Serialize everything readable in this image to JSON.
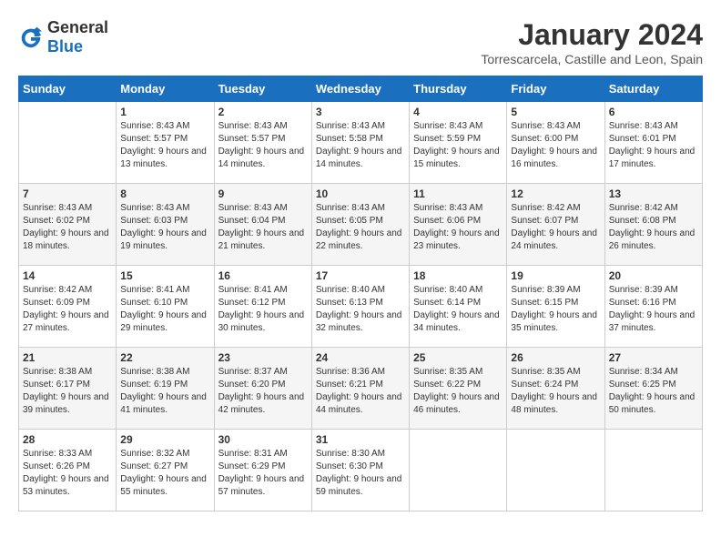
{
  "header": {
    "logo_general": "General",
    "logo_blue": "Blue",
    "month": "January 2024",
    "location": "Torrescarcela, Castille and Leon, Spain"
  },
  "calendar": {
    "days_of_week": [
      "Sunday",
      "Monday",
      "Tuesday",
      "Wednesday",
      "Thursday",
      "Friday",
      "Saturday"
    ],
    "weeks": [
      [
        {
          "day": "",
          "sunrise": "",
          "sunset": "",
          "daylight": ""
        },
        {
          "day": "1",
          "sunrise": "Sunrise: 8:43 AM",
          "sunset": "Sunset: 5:57 PM",
          "daylight": "Daylight: 9 hours and 13 minutes."
        },
        {
          "day": "2",
          "sunrise": "Sunrise: 8:43 AM",
          "sunset": "Sunset: 5:57 PM",
          "daylight": "Daylight: 9 hours and 14 minutes."
        },
        {
          "day": "3",
          "sunrise": "Sunrise: 8:43 AM",
          "sunset": "Sunset: 5:58 PM",
          "daylight": "Daylight: 9 hours and 14 minutes."
        },
        {
          "day": "4",
          "sunrise": "Sunrise: 8:43 AM",
          "sunset": "Sunset: 5:59 PM",
          "daylight": "Daylight: 9 hours and 15 minutes."
        },
        {
          "day": "5",
          "sunrise": "Sunrise: 8:43 AM",
          "sunset": "Sunset: 6:00 PM",
          "daylight": "Daylight: 9 hours and 16 minutes."
        },
        {
          "day": "6",
          "sunrise": "Sunrise: 8:43 AM",
          "sunset": "Sunset: 6:01 PM",
          "daylight": "Daylight: 9 hours and 17 minutes."
        }
      ],
      [
        {
          "day": "7",
          "sunrise": "Sunrise: 8:43 AM",
          "sunset": "Sunset: 6:02 PM",
          "daylight": "Daylight: 9 hours and 18 minutes."
        },
        {
          "day": "8",
          "sunrise": "Sunrise: 8:43 AM",
          "sunset": "Sunset: 6:03 PM",
          "daylight": "Daylight: 9 hours and 19 minutes."
        },
        {
          "day": "9",
          "sunrise": "Sunrise: 8:43 AM",
          "sunset": "Sunset: 6:04 PM",
          "daylight": "Daylight: 9 hours and 21 minutes."
        },
        {
          "day": "10",
          "sunrise": "Sunrise: 8:43 AM",
          "sunset": "Sunset: 6:05 PM",
          "daylight": "Daylight: 9 hours and 22 minutes."
        },
        {
          "day": "11",
          "sunrise": "Sunrise: 8:43 AM",
          "sunset": "Sunset: 6:06 PM",
          "daylight": "Daylight: 9 hours and 23 minutes."
        },
        {
          "day": "12",
          "sunrise": "Sunrise: 8:42 AM",
          "sunset": "Sunset: 6:07 PM",
          "daylight": "Daylight: 9 hours and 24 minutes."
        },
        {
          "day": "13",
          "sunrise": "Sunrise: 8:42 AM",
          "sunset": "Sunset: 6:08 PM",
          "daylight": "Daylight: 9 hours and 26 minutes."
        }
      ],
      [
        {
          "day": "14",
          "sunrise": "Sunrise: 8:42 AM",
          "sunset": "Sunset: 6:09 PM",
          "daylight": "Daylight: 9 hours and 27 minutes."
        },
        {
          "day": "15",
          "sunrise": "Sunrise: 8:41 AM",
          "sunset": "Sunset: 6:10 PM",
          "daylight": "Daylight: 9 hours and 29 minutes."
        },
        {
          "day": "16",
          "sunrise": "Sunrise: 8:41 AM",
          "sunset": "Sunset: 6:12 PM",
          "daylight": "Daylight: 9 hours and 30 minutes."
        },
        {
          "day": "17",
          "sunrise": "Sunrise: 8:40 AM",
          "sunset": "Sunset: 6:13 PM",
          "daylight": "Daylight: 9 hours and 32 minutes."
        },
        {
          "day": "18",
          "sunrise": "Sunrise: 8:40 AM",
          "sunset": "Sunset: 6:14 PM",
          "daylight": "Daylight: 9 hours and 34 minutes."
        },
        {
          "day": "19",
          "sunrise": "Sunrise: 8:39 AM",
          "sunset": "Sunset: 6:15 PM",
          "daylight": "Daylight: 9 hours and 35 minutes."
        },
        {
          "day": "20",
          "sunrise": "Sunrise: 8:39 AM",
          "sunset": "Sunset: 6:16 PM",
          "daylight": "Daylight: 9 hours and 37 minutes."
        }
      ],
      [
        {
          "day": "21",
          "sunrise": "Sunrise: 8:38 AM",
          "sunset": "Sunset: 6:17 PM",
          "daylight": "Daylight: 9 hours and 39 minutes."
        },
        {
          "day": "22",
          "sunrise": "Sunrise: 8:38 AM",
          "sunset": "Sunset: 6:19 PM",
          "daylight": "Daylight: 9 hours and 41 minutes."
        },
        {
          "day": "23",
          "sunrise": "Sunrise: 8:37 AM",
          "sunset": "Sunset: 6:20 PM",
          "daylight": "Daylight: 9 hours and 42 minutes."
        },
        {
          "day": "24",
          "sunrise": "Sunrise: 8:36 AM",
          "sunset": "Sunset: 6:21 PM",
          "daylight": "Daylight: 9 hours and 44 minutes."
        },
        {
          "day": "25",
          "sunrise": "Sunrise: 8:35 AM",
          "sunset": "Sunset: 6:22 PM",
          "daylight": "Daylight: 9 hours and 46 minutes."
        },
        {
          "day": "26",
          "sunrise": "Sunrise: 8:35 AM",
          "sunset": "Sunset: 6:24 PM",
          "daylight": "Daylight: 9 hours and 48 minutes."
        },
        {
          "day": "27",
          "sunrise": "Sunrise: 8:34 AM",
          "sunset": "Sunset: 6:25 PM",
          "daylight": "Daylight: 9 hours and 50 minutes."
        }
      ],
      [
        {
          "day": "28",
          "sunrise": "Sunrise: 8:33 AM",
          "sunset": "Sunset: 6:26 PM",
          "daylight": "Daylight: 9 hours and 53 minutes."
        },
        {
          "day": "29",
          "sunrise": "Sunrise: 8:32 AM",
          "sunset": "Sunset: 6:27 PM",
          "daylight": "Daylight: 9 hours and 55 minutes."
        },
        {
          "day": "30",
          "sunrise": "Sunrise: 8:31 AM",
          "sunset": "Sunset: 6:29 PM",
          "daylight": "Daylight: 9 hours and 57 minutes."
        },
        {
          "day": "31",
          "sunrise": "Sunrise: 8:30 AM",
          "sunset": "Sunset: 6:30 PM",
          "daylight": "Daylight: 9 hours and 59 minutes."
        },
        {
          "day": "",
          "sunrise": "",
          "sunset": "",
          "daylight": ""
        },
        {
          "day": "",
          "sunrise": "",
          "sunset": "",
          "daylight": ""
        },
        {
          "day": "",
          "sunrise": "",
          "sunset": "",
          "daylight": ""
        }
      ]
    ]
  }
}
